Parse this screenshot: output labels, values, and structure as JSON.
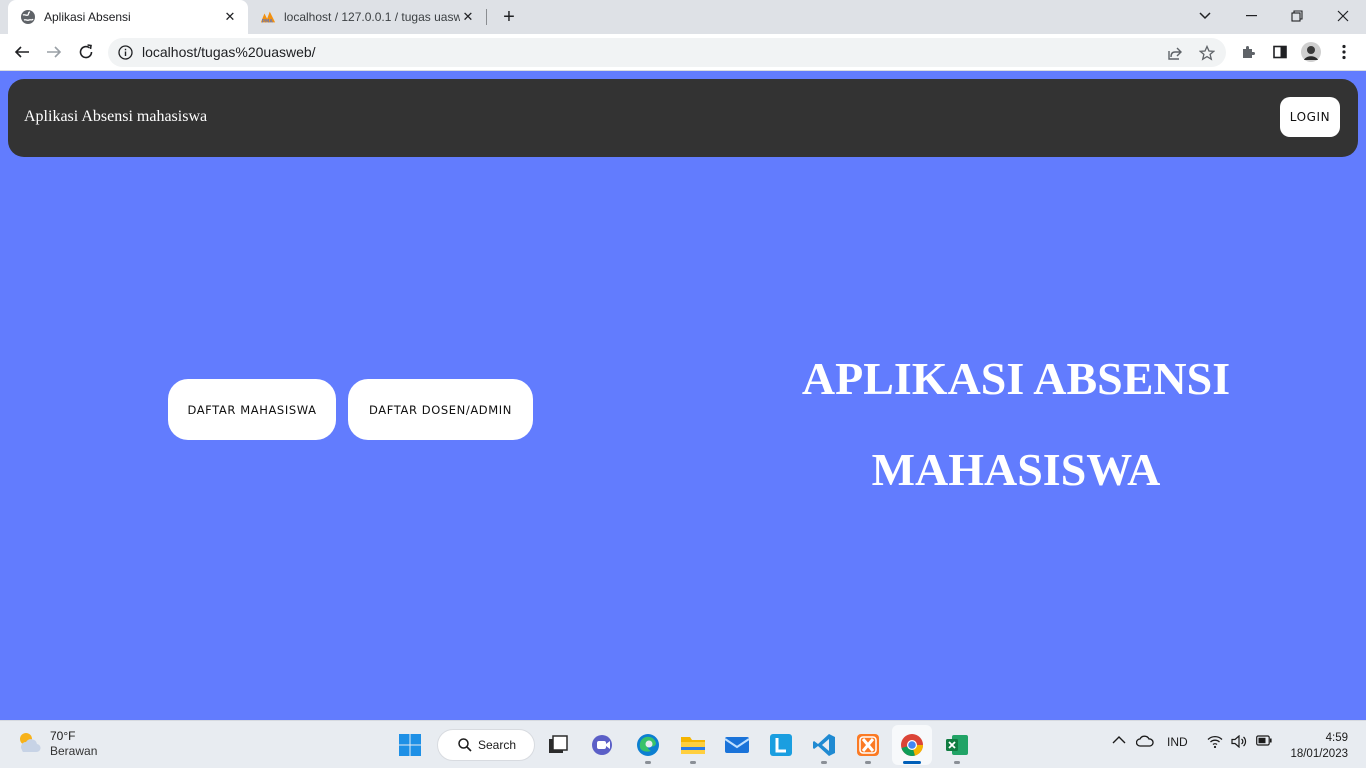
{
  "browser": {
    "tabs": [
      {
        "title": "Aplikasi Absensi",
        "active": true
      },
      {
        "title": "localhost / 127.0.0.1 / tugas uasw",
        "active": false
      }
    ],
    "url": "localhost/tugas%20uasweb/"
  },
  "page": {
    "brand": "Aplikasi Absensi mahasiswa",
    "login_label": "LOGIN",
    "buttons": {
      "daftar_mahasiswa": "DAFTAR MAHASISWA",
      "daftar_dosen": "DAFTAR DOSEN/ADMIN"
    },
    "hero": [
      "APLIKASI ABSENSI",
      "MAHASISWA"
    ],
    "colors": {
      "background": "#627cfe",
      "navbar": "#333333",
      "button": "#ffffff"
    }
  },
  "taskbar": {
    "weather": {
      "temp": "70°F",
      "condition": "Berawan"
    },
    "search_label": "Search",
    "language": "IND",
    "time": "4:59",
    "date": "18/01/2023",
    "apps": [
      "start-icon",
      "task-view-icon",
      "meet-icon",
      "edge-icon",
      "file-explorer-icon",
      "mail-icon",
      "l-app-icon",
      "vscode-icon",
      "xampp-icon",
      "chrome-icon",
      "excel-icon"
    ]
  }
}
